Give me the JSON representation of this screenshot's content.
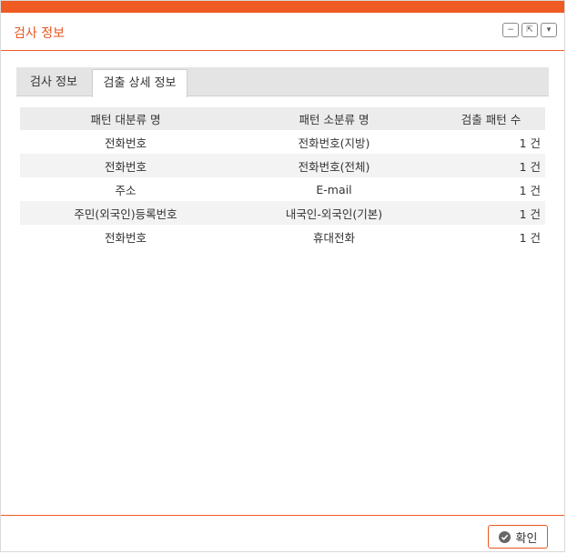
{
  "window": {
    "title": "검사 정보",
    "buttons": {
      "minimize": "−",
      "popout": "⇱",
      "dropdown": "▾"
    }
  },
  "tabs": [
    {
      "label": "검사 정보"
    },
    {
      "label": "검출 상세 정보"
    }
  ],
  "table": {
    "headers": [
      "패턴 대분류 명",
      "패턴 소분류 명",
      "검출 패턴 수"
    ],
    "rows": [
      [
        "전화번호",
        "전화번호(지방)",
        "1 건"
      ],
      [
        "전화번호",
        "전화번호(전체)",
        "1 건"
      ],
      [
        "주소",
        "E-mail",
        "1 건"
      ],
      [
        "주민(외국인)등록번호",
        "내국인-외국인(기본)",
        "1 건"
      ],
      [
        "전화번호",
        "휴대전화",
        "1 건"
      ]
    ]
  },
  "footer": {
    "ok_label": "확인"
  },
  "colors": {
    "accent": "#f05a23",
    "header_bg": "#ececec",
    "row_alt": "#f3f3f3"
  }
}
